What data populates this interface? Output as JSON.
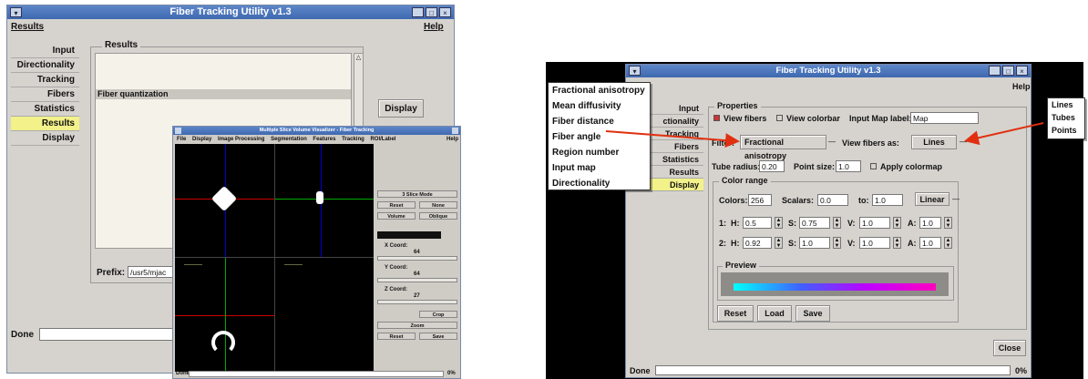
{
  "left": {
    "title": "Fiber Tracking Utility v1.3",
    "menu": {
      "results": "Results",
      "help": "Help"
    },
    "nav": [
      "Input",
      "Directionality",
      "Tracking",
      "Fibers",
      "Statistics",
      "Results",
      "Display"
    ],
    "results_group": "Results",
    "results_items": [
      "Fiber quantization"
    ],
    "display_button": "Display",
    "prefix_label": "Prefix:",
    "prefix_value": "/usr5/mjac",
    "status": "Done"
  },
  "viewer": {
    "title": "Multiple Slice Volume Visualizer - Fiber Tracking",
    "menu": [
      "File",
      "Display",
      "Image Processing",
      "Segmentation",
      "Features",
      "Tracking",
      "ROI/Label"
    ],
    "help": "Help",
    "panel": {
      "three_slice": "3 Slice Mode",
      "reset": "Reset",
      "none": "None",
      "volume": "Volume",
      "oblique": "Oblique",
      "x_coord": "X Coord:",
      "x_val": "64",
      "y_coord": "Y Coord:",
      "y_val": "64",
      "z_coord": "Z Coord:",
      "z_val": "27",
      "zoom": "Zoom",
      "reset2": "Reset",
      "save": "Save",
      "crop": "Crop"
    },
    "status": "Done",
    "percent": "0%"
  },
  "right": {
    "title": "Fiber Tracking Utility v1.3",
    "menu_help": "Help",
    "nav_visible": [
      "Input",
      "ctionality",
      "Tracking",
      "Fibers",
      "Statistics",
      "Results",
      "Display"
    ],
    "properties_label": "Properties",
    "view_fibers": "View fibers",
    "view_colorbar": "View colorbar",
    "input_map_label": "Input Map label:",
    "input_map_value": "Map",
    "filter_label": "Filter:",
    "filter_value": "Fractional anisotropy",
    "view_as_label": "View fibers as:",
    "view_as_value": "Lines",
    "tube_radius_label": "Tube radius:",
    "tube_radius_value": "0.20",
    "point_size_label": "Point size:",
    "point_size_value": "1.0",
    "apply_colormap": "Apply colormap",
    "color_range_label": "Color range",
    "colors_label": "Colors:",
    "colors_value": "256",
    "scalars_label": "Scalars:",
    "scalars_value": "0.0",
    "to_label": "to:",
    "to_value": "1.0",
    "linear": "Linear",
    "row1": {
      "n": "1:",
      "h": "0.5",
      "s": "0.75",
      "v": "1.0",
      "a": "1.0"
    },
    "row2": {
      "n": "2:",
      "h": "0.92",
      "s": "1.0",
      "v": "1.0",
      "a": "1.0"
    },
    "h_label": "H:",
    "s_label": "S:",
    "v_label": "V:",
    "a_label": "A:",
    "preview_label": "Preview",
    "reset": "Reset",
    "load": "Load",
    "save": "Save",
    "close": "Close",
    "status": "Done",
    "percent": "0%"
  },
  "filter_popup": [
    "Fractional anisotropy",
    "Mean diffusivity",
    "Fiber distance",
    "Fiber angle",
    "Region number",
    "Input map",
    "Directionality"
  ],
  "view_popup": [
    "Lines",
    "Tubes",
    "Points"
  ]
}
